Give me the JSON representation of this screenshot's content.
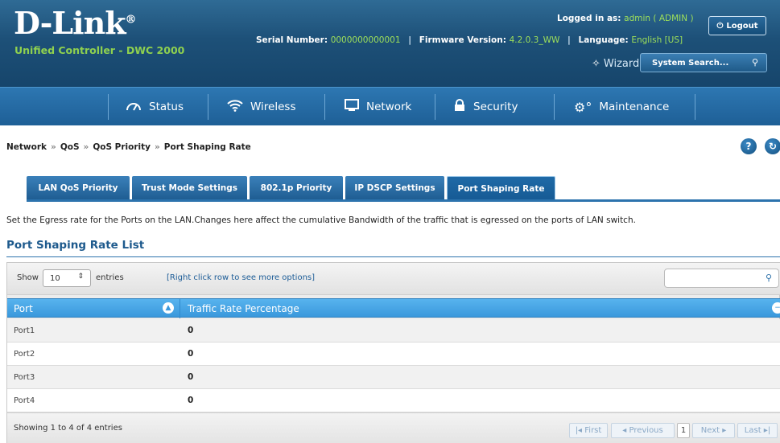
{
  "header": {
    "logo": "D-Link",
    "logo_mark": "®",
    "subtitle": "Unified Controller - DWC 2000",
    "serial_label": "Serial Number:",
    "serial_value": "0000000000001",
    "firmware_label": "Firmware Version:",
    "firmware_value": "4.2.0.3_WW",
    "language_label": "Language:",
    "language_value": "English [US]",
    "logged_in_label": "Logged in as:",
    "logged_in_value": "admin ( ADMIN )",
    "logout_label": "Logout",
    "wizard_label": "Wizard",
    "search_placeholder": "System Search...",
    "separator": "|"
  },
  "nav": {
    "items": [
      {
        "label": "Status",
        "icon": "gauge-icon"
      },
      {
        "label": "Wireless",
        "icon": "wifi-icon"
      },
      {
        "label": "Network",
        "icon": "monitor-icon"
      },
      {
        "label": "Security",
        "icon": "lock-icon"
      },
      {
        "label": "Maintenance",
        "icon": "gears-icon"
      }
    ]
  },
  "breadcrumb": {
    "items": [
      "Network",
      "QoS",
      "QoS Priority",
      "Port Shaping Rate"
    ],
    "separator": "»"
  },
  "tabs": [
    {
      "label": "LAN QoS Priority",
      "active": false
    },
    {
      "label": "Trust Mode Settings",
      "active": false
    },
    {
      "label": "802.1p Priority",
      "active": false
    },
    {
      "label": "IP DSCP Settings",
      "active": false
    },
    {
      "label": "Port Shaping Rate",
      "active": true
    }
  ],
  "description": "Set the Egress rate for the Ports on the LAN.Changes here affect the cumulative Bandwidth of the traffic that is egressed on the ports of LAN switch.",
  "section_title": "Port Shaping Rate List",
  "table": {
    "show_label": "Show",
    "entries_value": "10",
    "entries_label": "entries",
    "hint": "[Right click row to see more options]",
    "columns": [
      "Port",
      "Traffic Rate Percentage"
    ],
    "rows": [
      {
        "port": "Port1",
        "rate": "0"
      },
      {
        "port": "Port2",
        "rate": "0"
      },
      {
        "port": "Port3",
        "rate": "0"
      },
      {
        "port": "Port4",
        "rate": "0"
      }
    ],
    "showing": "Showing 1 to 4 of 4 entries",
    "pager": {
      "first": "First",
      "previous": "Previous",
      "page": "1",
      "next": "Next",
      "last": "Last"
    }
  },
  "colors": {
    "header_bg": "#1d5078",
    "nav_bg": "#2d77b2",
    "accent_green": "#8fd14f",
    "table_header": "#3a98dc",
    "link_blue": "#1c5c97"
  }
}
